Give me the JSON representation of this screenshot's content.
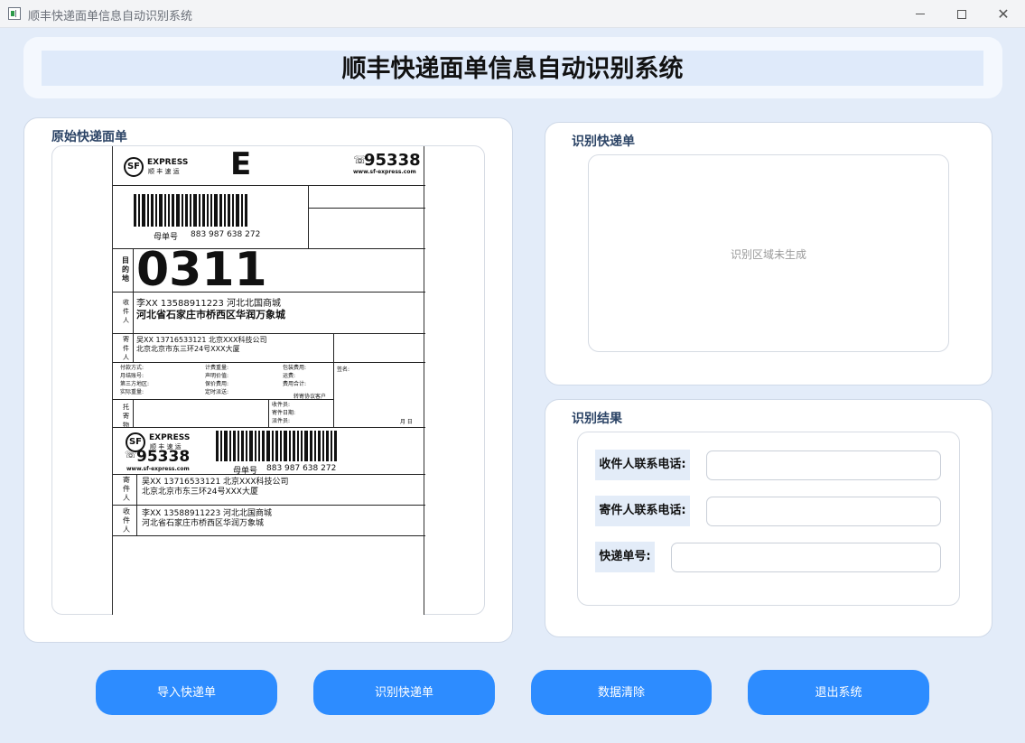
{
  "window": {
    "title": "顺丰快递面单信息自动识别系统",
    "minimize_icon": "minimize-icon",
    "maximize_icon": "maximize-icon",
    "close_icon": "close-icon"
  },
  "header": {
    "title": "顺丰快递面单信息自动识别系统"
  },
  "original_panel": {
    "label": "原始快递面单"
  },
  "waybill": {
    "brand_en": "EXPRESS",
    "brand_cn": "顺 丰 速 运",
    "brand_mark": "SF",
    "service_letter": "E",
    "hotline": "95338",
    "website": "www.sf-express.com",
    "tracking_label": "母单号",
    "tracking_number": "883 987 638 272",
    "dest_label": "目的地",
    "dest_code": "0311",
    "recipient_label": "收件人",
    "recipient_line1": "李XX    13588911223  河北北国商城",
    "recipient_line2": "河北省石家庄市桥西区华润万象城",
    "sender_label": "寄件人",
    "sender_line1": "吴XX    13716533121  北京XXX科技公司",
    "sender_line2": "北京北京市东三环24号XXX大厦",
    "payment_col1": [
      "付款方式:",
      "月结账号:",
      "第三方地区:",
      "实际重量:"
    ],
    "payment_col2": [
      "计费重量:",
      "声明价值:",
      "保价费用:",
      "定时派送:"
    ],
    "payment_col3": [
      "包装费用:",
      "运费:",
      "费用合计:"
    ],
    "signature_label": "签名:",
    "transfer_label": "转寄协议客户",
    "goods_label": "托寄物",
    "receiver_info": [
      "收件员:",
      "寄件日期:",
      "派件员:"
    ],
    "date_label": "月      日",
    "stub_tracking_label": "母单号",
    "stub_tracking_number": "883 987 638 272",
    "stub_sender_line1": "吴XX    13716533121  北京XXX科技公司",
    "stub_sender_line2": "北京北京市东三环24号XXX大厦",
    "stub_recipient_line1": "李XX    13588911223  河北北国商城",
    "stub_recipient_line2": "河北省石家庄市桥西区华润万象城"
  },
  "recognized_panel": {
    "label": "识别快递单",
    "placeholder": "识别区域未生成"
  },
  "result_panel": {
    "label": "识别结果",
    "fields": [
      {
        "label": "收件人联系电话:",
        "value": ""
      },
      {
        "label": "寄件人联系电话:",
        "value": ""
      },
      {
        "label": "快递单号:",
        "value": ""
      }
    ]
  },
  "buttons": {
    "import": "导入快递单",
    "recognize": "识别快递单",
    "clear": "数据清除",
    "exit": "退出系统"
  },
  "colors": {
    "background": "#e3ecf9",
    "button": "#2d8cff",
    "label_text": "#2c4466"
  }
}
